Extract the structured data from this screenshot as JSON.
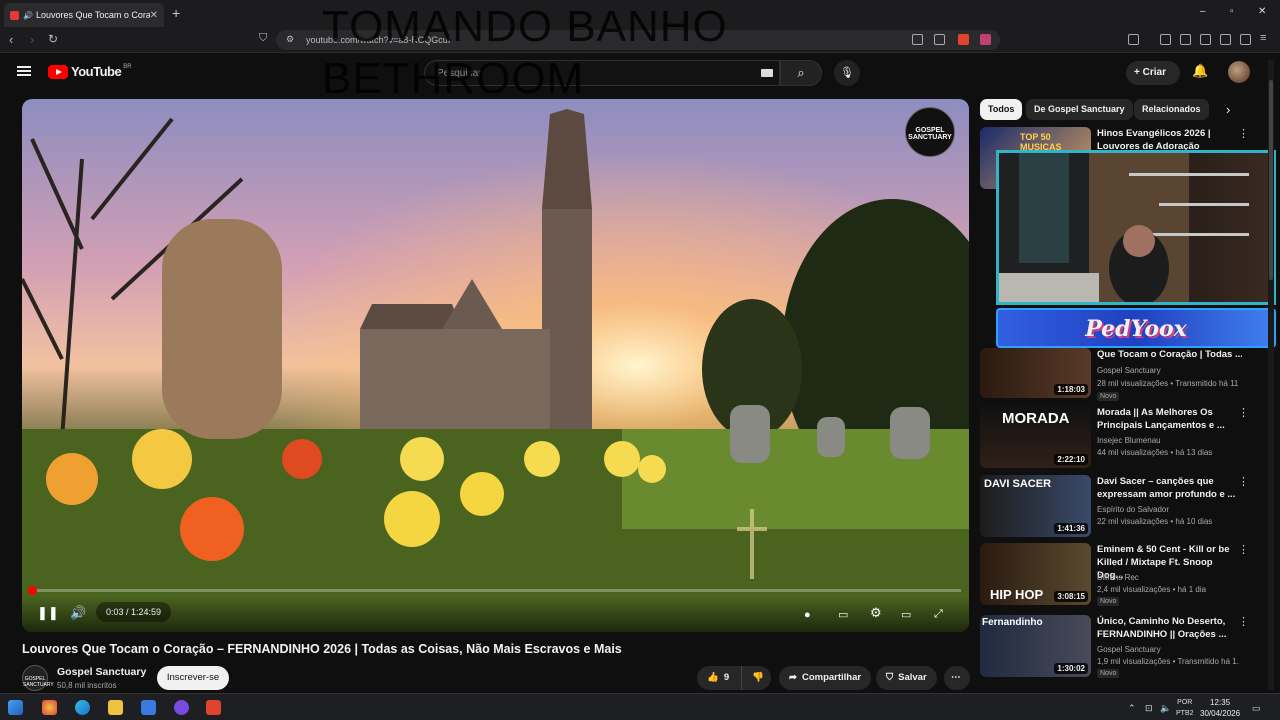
{
  "browser": {
    "tab_title": "Louvores Que Tocam o Coraç...",
    "new_tab": "+",
    "url": "youtube.com/watch?v=a8-RCQGcuI",
    "window_controls": [
      "–",
      "▫",
      "✕"
    ]
  },
  "stream_overlay": {
    "line1": "TOMANDO BANHO",
    "line2": "BETHROOM"
  },
  "youtube": {
    "logo": "YouTube",
    "country": "BR",
    "search_placeholder": "Pesquisar",
    "create_label": "Criar"
  },
  "player": {
    "badge_text": "GOSPEL SANCTUARY",
    "time": "0:03 / 1:24:59",
    "progress_fraction": 0.002
  },
  "video": {
    "title": "Louvores Que Tocam o Coração – FERNANDINHO 2026 | Todas as Coisas, Não Mais Escravos e Mais",
    "channel": "Gospel Sanctuary",
    "subscribers": "50,8 mil inscritos",
    "subscribe_label": "Inscrever-se",
    "likes": "9",
    "share_label": "Compartilhar",
    "save_label": "Salvar"
  },
  "chips": [
    "Todos",
    "De Gospel Sanctuary",
    "Relacionados"
  ],
  "recommendations": [
    {
      "title": "Hinos Evangélicos 2026 | Louvores de Adoração",
      "channel": "",
      "meta": "",
      "duration": "",
      "thumb_text": "TOP 50 MUSICAS",
      "badge": ""
    },
    {
      "title": "Que Tocam o Coração | Todas ...",
      "channel": "Gospel Sanctuary",
      "meta": "28 mil visualizações • Transmitido há 11...",
      "duration": "1:18:03",
      "thumb_text": "",
      "badge": "Novo"
    },
    {
      "title": "Morada || As Melhores Os Principais Lançamentos e ...",
      "channel": "Insejec Blumenau",
      "meta": "44 mil visualizações • há 13 dias",
      "duration": "2:22:10",
      "thumb_text": "MORADA",
      "badge": ""
    },
    {
      "title": "Davi Sacer – canções que expressam amor profundo e ...",
      "channel": "Espírito do Salvador",
      "meta": "22 mil visualizações • há 10 dias",
      "duration": "1:41:36",
      "thumb_text": "DAVI SACER",
      "badge": ""
    },
    {
      "title": "Eminem & 50 Cent - Kill or be Killed / Mixtape Ft. Snoop Dog...",
      "channel": "Billions Rec",
      "meta": "2,4 mil visualizações • há 1 dia",
      "duration": "3:08:15",
      "thumb_text": "HIP HOP",
      "badge": "Novo"
    },
    {
      "title": "Único, Caminho No Deserto, FERNANDINHO || Orações ...",
      "channel": "Gospel Sanctuary",
      "meta": "1,9 mil visualizações • Transmitido há 1...",
      "duration": "1:30:02",
      "thumb_text": "Fernandinho",
      "badge": "Novo"
    }
  ],
  "stream_banner": "PedYoox",
  "taskbar": {
    "lang": "POR",
    "kbd": "PTB2",
    "time": "12:35",
    "date": "30/04/2026"
  }
}
